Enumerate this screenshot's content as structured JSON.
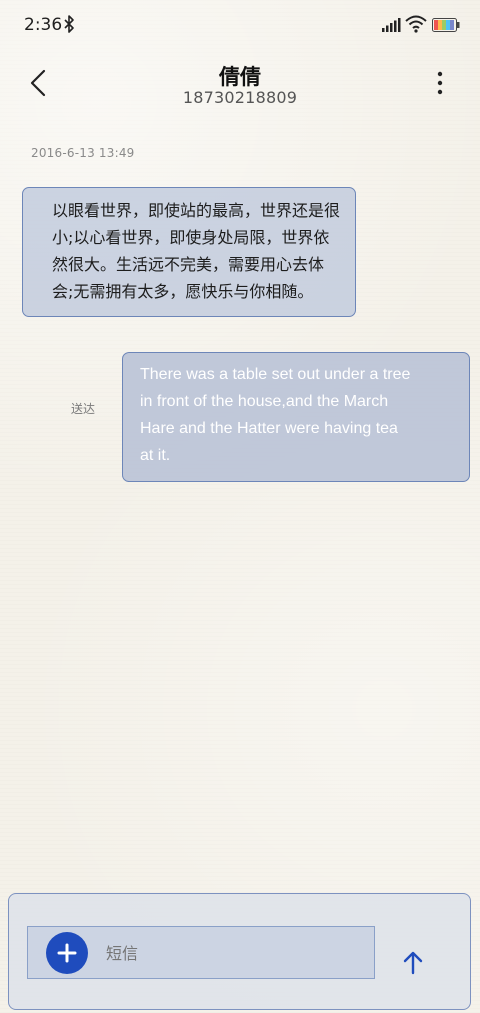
{
  "status_bar": {
    "time": "2:36",
    "icons": [
      "bluetooth-icon",
      "signal-icon",
      "wifi-icon",
      "battery-icon"
    ]
  },
  "header": {
    "contact_name": "倩倩",
    "phone_number": "18730218809"
  },
  "conversation": {
    "timestamp": "2016-6-13 13:49",
    "messages": [
      {
        "direction": "incoming",
        "text": "以眼看世界，即使站的最高，世界还是很小;以心看世界，即使身处局限，世界依然很大。生活远不完美，需要用心去体会;无需拥有太多，愿快乐与你相随。",
        "lines": [
          "以眼看世界，即使站的最高，世界还是很",
          "小;以心看世界，即使身处局限，世界依",
          "然很大。生活远不完美，需要用心去体",
          "会;无需拥有太多，愿快乐与你相随。"
        ]
      },
      {
        "direction": "outgoing",
        "status": "送达",
        "text": "There was a table set out under a tree in front of the house,and the March Hare and the Hatter were having tea at it.",
        "lines": [
          "There was a table set out under a tree",
          "in front of the house,and the March",
          "Hare and the Hatter were having tea",
          "at it."
        ]
      }
    ]
  },
  "composer": {
    "placeholder": "短信",
    "value": ""
  },
  "colors": {
    "accent": "#1f4cbd",
    "bubble_border": "#6d86b8",
    "incoming_bubble": "#c1cadd",
    "outgoing_bubble": "#b8c1d6"
  }
}
